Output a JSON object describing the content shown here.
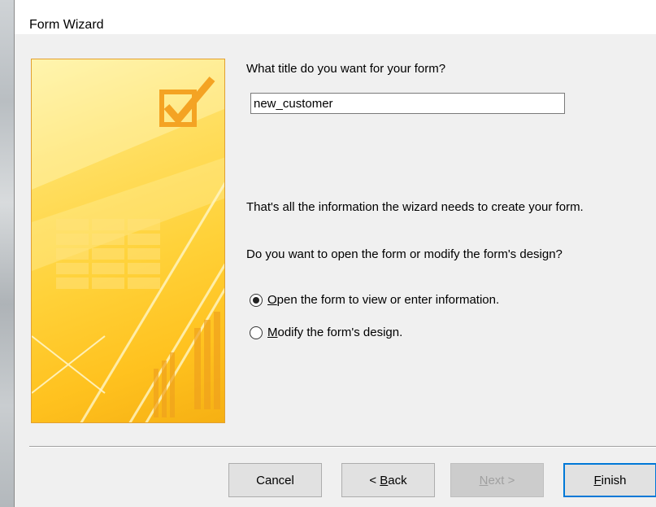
{
  "window": {
    "title": "Form Wizard"
  },
  "form_title": {
    "question": "What title do you want for your form?",
    "value": "new_customer"
  },
  "info_text": "That's all the information the wizard needs to create your form.",
  "prompt": "Do you want to open the form or modify the form's design?",
  "options": [
    {
      "mnemonic": "O",
      "rest": "pen the form to view or enter information.",
      "selected": true
    },
    {
      "mnemonic": "M",
      "rest": "odify the form's design.",
      "selected": false
    }
  ],
  "buttons": {
    "cancel": "Cancel",
    "back": {
      "prefix": "< ",
      "mnemonic": "B",
      "rest": "ack"
    },
    "next": {
      "mnemonic": "N",
      "rest": "ext >"
    },
    "finish": {
      "mnemonic": "F",
      "rest": "inish"
    }
  },
  "colors": {
    "accent": "#0078d7",
    "art_orange": "#f4a323",
    "art_yellow": "#ffd23a"
  },
  "icons": {
    "art": "checkbox-checkmark-art"
  }
}
